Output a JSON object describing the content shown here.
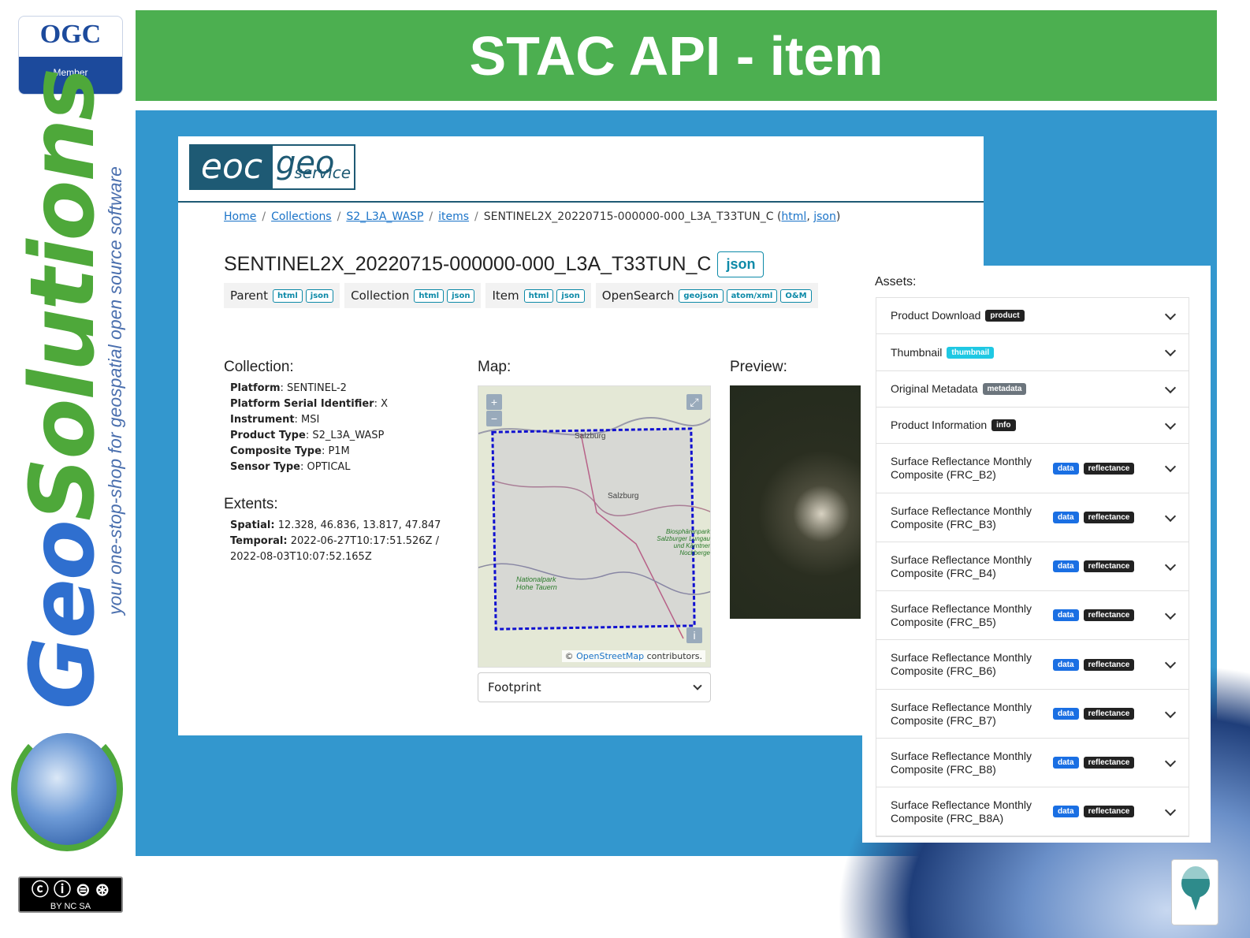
{
  "slide": {
    "title": "STAC API - item",
    "ogc_logo": {
      "text": "OGC",
      "member": "Member"
    },
    "brand": {
      "geo": "Geo",
      "solutions": "Solutions",
      "tagline": "your one-stop-shop for geospatial open source software"
    },
    "cc_license": "BY NC SA"
  },
  "eoc_logo": {
    "left": "eoc",
    "right": "geo",
    "sub": "service"
  },
  "breadcrumb": {
    "items": [
      "Home",
      "Collections",
      "S2_L3A_WASP",
      "items"
    ],
    "current": "SENTINEL2X_20220715-000000-000_L3A_T33TUN_C",
    "html": "html",
    "json": "json"
  },
  "item": {
    "title": "SENTINEL2X_20220715-000000-000_L3A_T33TUN_C",
    "json_button": "json"
  },
  "links": [
    {
      "label": "Parent",
      "buttons": [
        "html",
        "json"
      ]
    },
    {
      "label": "Collection",
      "buttons": [
        "html",
        "json"
      ]
    },
    {
      "label": "Item",
      "buttons": [
        "html",
        "json"
      ]
    },
    {
      "label": "OpenSearch",
      "buttons": [
        "geojson",
        "atom/xml",
        "O&M"
      ]
    }
  ],
  "collection": {
    "heading": "Collection:",
    "props": [
      {
        "k": "Platform",
        "v": ": SENTINEL-2"
      },
      {
        "k": "Platform Serial Identifier",
        "v": ": X"
      },
      {
        "k": "Instrument",
        "v": ": MSI"
      },
      {
        "k": "Product Type",
        "v": ": S2_L3A_WASP"
      },
      {
        "k": "Composite Type",
        "v": ": P1M"
      },
      {
        "k": "Sensor Type",
        "v": ": OPTICAL"
      }
    ]
  },
  "extents": {
    "heading": "Extents:",
    "spatial_label": "Spatial:",
    "spatial": "12.328, 46.836, 13.817, 47.847",
    "temporal_label": "Temporal:",
    "temporal": "2022-06-27T10:17:51.526Z / 2022-08-03T10:07:52.165Z"
  },
  "map": {
    "heading": "Map:",
    "zoom_in": "+",
    "zoom_out": "−",
    "fullscreen": "⤢",
    "info": "i",
    "labels": [
      "Salzburg",
      "Salzburg",
      "Biosphärenpark Salzburger Lungau und Kärntner Nockberge",
      "Nationalpark Hohe Tauern"
    ],
    "attribution_prefix": "©",
    "attribution_link": "OpenStreetMap",
    "attribution_suffix": "contributors.",
    "select_value": "Footprint"
  },
  "preview": {
    "heading": "Preview:"
  },
  "assets": {
    "heading": "Assets:",
    "items": [
      {
        "name": "Product Download",
        "badges": [
          {
            "text": "product",
            "style": "bk"
          }
        ]
      },
      {
        "name": "Thumbnail",
        "badges": [
          {
            "text": "thumbnail",
            "style": "bc"
          }
        ]
      },
      {
        "name": "Original Metadata",
        "badges": [
          {
            "text": "metadata",
            "style": "bg"
          }
        ]
      },
      {
        "name": "Product Information",
        "badges": [
          {
            "text": "info",
            "style": "bk"
          }
        ]
      },
      {
        "name": "Surface Reflectance Monthly Composite (FRC_B2)",
        "badges": [
          {
            "text": "data",
            "style": "bb"
          },
          {
            "text": "reflectance",
            "style": "bk"
          }
        ]
      },
      {
        "name": "Surface Reflectance Monthly Composite (FRC_B3)",
        "badges": [
          {
            "text": "data",
            "style": "bb"
          },
          {
            "text": "reflectance",
            "style": "bk"
          }
        ]
      },
      {
        "name": "Surface Reflectance Monthly Composite (FRC_B4)",
        "badges": [
          {
            "text": "data",
            "style": "bb"
          },
          {
            "text": "reflectance",
            "style": "bk"
          }
        ]
      },
      {
        "name": "Surface Reflectance Monthly Composite (FRC_B5)",
        "badges": [
          {
            "text": "data",
            "style": "bb"
          },
          {
            "text": "reflectance",
            "style": "bk"
          }
        ]
      },
      {
        "name": "Surface Reflectance Monthly Composite (FRC_B6)",
        "badges": [
          {
            "text": "data",
            "style": "bb"
          },
          {
            "text": "reflectance",
            "style": "bk"
          }
        ]
      },
      {
        "name": "Surface Reflectance Monthly Composite (FRC_B7)",
        "badges": [
          {
            "text": "data",
            "style": "bb"
          },
          {
            "text": "reflectance",
            "style": "bk"
          }
        ]
      },
      {
        "name": "Surface Reflectance Monthly Composite (FRC_B8)",
        "badges": [
          {
            "text": "data",
            "style": "bb"
          },
          {
            "text": "reflectance",
            "style": "bk"
          }
        ]
      },
      {
        "name": "Surface Reflectance Monthly Composite (FRC_B8A)",
        "badges": [
          {
            "text": "data",
            "style": "bb"
          },
          {
            "text": "reflectance",
            "style": "bk"
          }
        ]
      }
    ]
  },
  "colors": {
    "header_green": "#4caf50",
    "panel_blue": "#3397ce",
    "link_teal": "#0d8aa8"
  }
}
